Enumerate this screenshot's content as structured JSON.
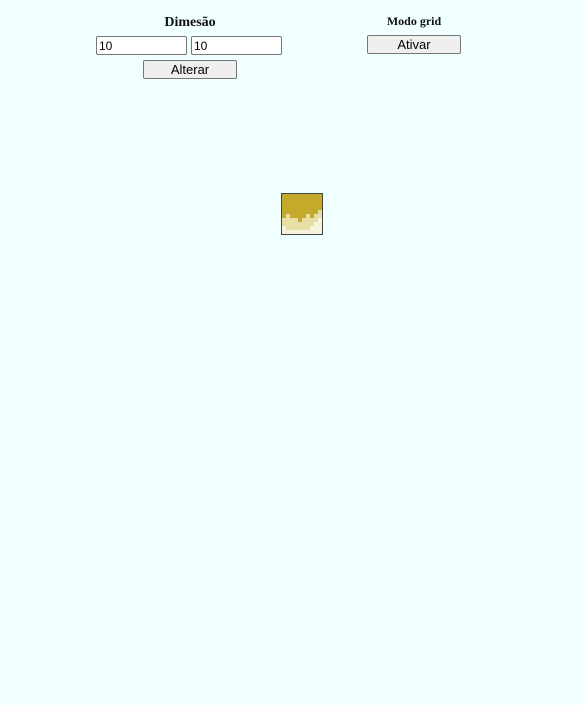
{
  "dimension": {
    "title": "Dimesão",
    "width_value": "10",
    "height_value": "10",
    "apply_label": "Alterar"
  },
  "grid_mode": {
    "title": "Modo grid",
    "toggle_label": "Ativar"
  },
  "drawing": {
    "cols": 10,
    "rows": 10,
    "colors": {
      "gold": "#c3aa2b",
      "light": "#e8dfa5",
      "pale": "#f7f2dc"
    },
    "pixels": [
      "gold",
      "gold",
      "gold",
      "gold",
      "gold",
      "gold",
      "gold",
      "gold",
      "gold",
      "gold",
      "gold",
      "gold",
      "gold",
      "gold",
      "gold",
      "gold",
      "gold",
      "gold",
      "gold",
      "gold",
      "gold",
      "gold",
      "gold",
      "gold",
      "gold",
      "gold",
      "gold",
      "gold",
      "gold",
      "gold",
      "gold",
      "gold",
      "gold",
      "gold",
      "gold",
      "gold",
      "gold",
      "gold",
      "gold",
      "gold",
      "gold",
      "gold",
      "gold",
      "gold",
      "gold",
      "gold",
      "gold",
      "gold",
      "gold",
      "light",
      "gold",
      "light",
      "gold",
      "gold",
      "gold",
      "gold",
      "light",
      "gold",
      "light",
      "light",
      "light",
      "light",
      "light",
      "light",
      "gold",
      "light",
      "light",
      "light",
      "light",
      "pale",
      "light",
      "light",
      "light",
      "light",
      "light",
      "light",
      "light",
      "light",
      "pale",
      "pale",
      "pale",
      "light",
      "light",
      "light",
      "light",
      "light",
      "light",
      "pale",
      "pale",
      "pale",
      "pale",
      "pale",
      "pale",
      "pale",
      "pale",
      "pale",
      "pale",
      "pale",
      "pale",
      "pale"
    ]
  }
}
